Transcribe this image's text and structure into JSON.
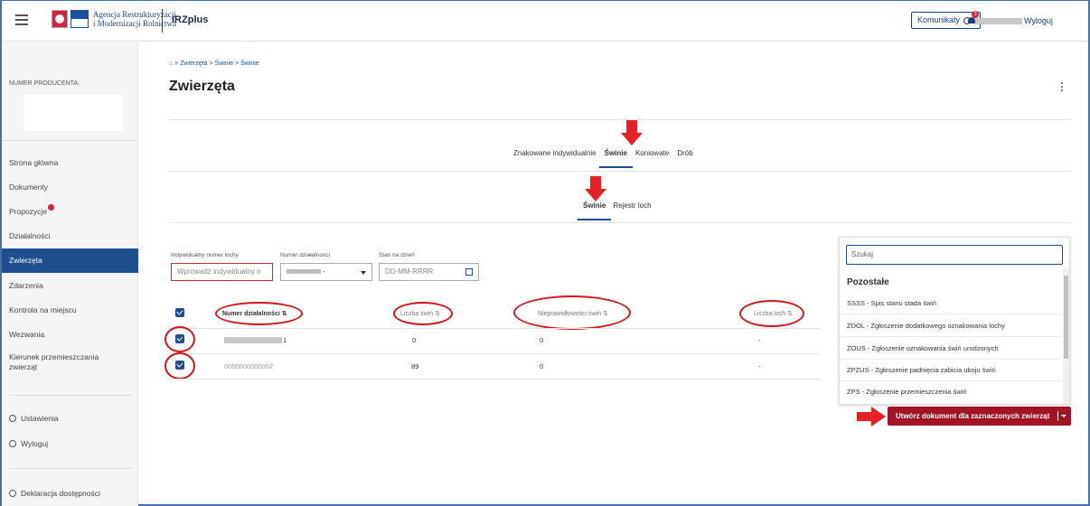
{
  "header": {
    "logo_line1": "Agencja Restrukturyzacji",
    "logo_line2": "i Modernizacji Rolnictwa",
    "app_name": "IRZplus",
    "messages_label": "Komunikaty",
    "messages_badge": "3",
    "logout_label": "Wyloguj",
    "menu_icon": "hamburger-icon",
    "bell_icon": "bell-icon",
    "user_icon": "user-icon"
  },
  "sidebar": {
    "producer_label": "NUMER PRODUCENTA:",
    "items": [
      {
        "label": "Strona główna"
      },
      {
        "label": "Dokumenty"
      },
      {
        "label": "Propozycje"
      },
      {
        "label": "Działalności"
      },
      {
        "label": "Zwierzęta"
      },
      {
        "label": "Zdarzenia"
      },
      {
        "label": "Kontrola na miejscu"
      },
      {
        "label": "Wezwania"
      },
      {
        "label": "Kierunek przemieszczania zwierząt"
      }
    ],
    "settings": "Ustawienia",
    "logout": "Wyloguj",
    "accessibility": "Deklaracja dostępności",
    "active_color": "#1d4f91"
  },
  "main": {
    "breadcrumb": "⌂ > Zwierzęta > Świnie > Świnie",
    "title": "Zwierzęta",
    "tabs": [
      "Znakowane indywidualnie",
      "Świnie",
      "Koniowate",
      "Drób"
    ],
    "subtabs": [
      "Świnie",
      "Rejestr loch"
    ],
    "filters": {
      "sow_label": "Indywidualny numer lochy",
      "sow_placeholder": "Wprowadź indywidualny n",
      "activity_label": "Numer działalności",
      "activity_value_suffix": "-",
      "date_label": "Stan na dzień",
      "date_placeholder": "DD-MM-RRRR"
    },
    "table": {
      "headers": [
        "Numer działalności",
        "Liczba świń",
        "Nieprawidłowości świń",
        "Liczba loch"
      ],
      "rows": [
        {
          "number_suffix": "1",
          "pigs": "0",
          "irregularities": "0",
          "sows": "-"
        },
        {
          "number": "0000000000002",
          "pigs": "89",
          "irregularities": "0",
          "sows": "-"
        }
      ]
    }
  },
  "dropdown": {
    "search_placeholder": "Szukaj",
    "section": "Pozostałe",
    "items": [
      "SSSS - Spis stanu stada świń",
      "ZDOL - Zgłoszenie dodatkowego oznakowania lochy",
      "ZOUS - Zgłoszenie oznakowania świń urodzonych",
      "ZPZUS - Zgłoszenie padnięcia zabicia uboju świń",
      "ZPS - Zgłoszenie przemieszczenia świń"
    ]
  },
  "create_button": "Utwórz dokument dla zaznaczonych zwierząt",
  "colors": {
    "accent": "#1d4f91",
    "button": "#a01425",
    "annotation_red": "#e52027"
  }
}
